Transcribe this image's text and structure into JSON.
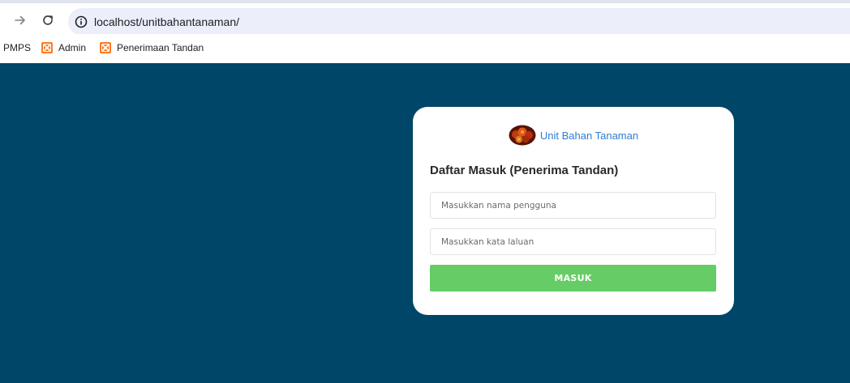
{
  "browser": {
    "url": "localhost/unitbahantanaman/",
    "bookmarks": [
      {
        "label": "PMPS",
        "icon": "none"
      },
      {
        "label": "Admin",
        "icon": "xampp-icon"
      },
      {
        "label": "Penerimaan Tandan",
        "icon": "xampp-icon"
      }
    ]
  },
  "login": {
    "brand_name": "Unit Bahan Tanaman",
    "brand_logo": "oil-palm-fruit-logo",
    "title": "Daftar Masuk (Penerima Tandan)",
    "username_placeholder": "Masukkan nama pengguna",
    "password_placeholder": "Masukkan kata laluan",
    "submit_label": "MASUK"
  },
  "colors": {
    "page_background": "#004668",
    "card_background": "#ffffff",
    "submit_button": "#66cc66",
    "brand_text": "#2f7fd1"
  }
}
